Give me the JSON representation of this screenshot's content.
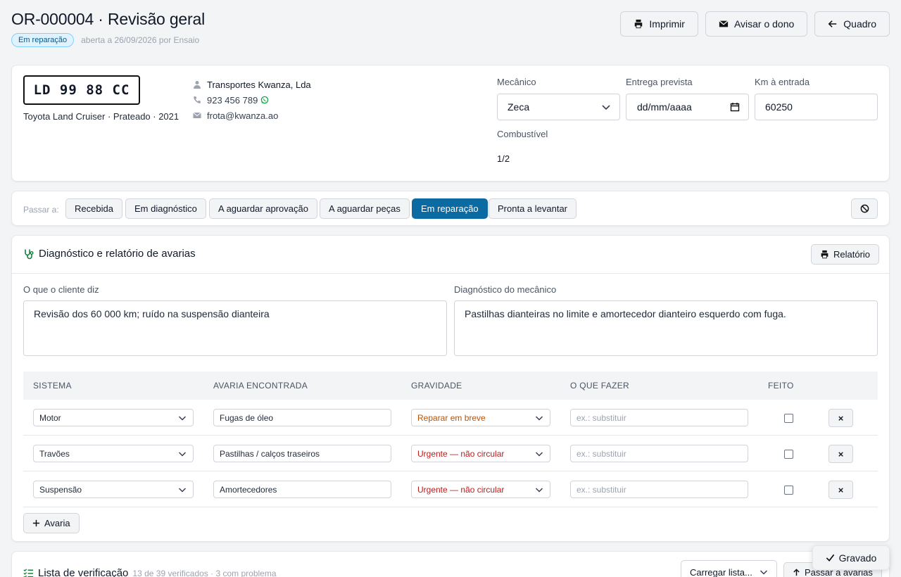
{
  "header": {
    "title": "OR-000004 · Revisão geral",
    "status_badge": "Em reparação",
    "meta": "aberta a 26/09/2026 por Ensaio",
    "buttons": {
      "print": "Imprimir",
      "notify": "Avisar o dono",
      "board": "Quadro"
    }
  },
  "vehicle": {
    "plate": "LD 99 88 CC",
    "description": "Toyota Land Cruiser · Prateado · 2021"
  },
  "customer": {
    "name": "Transportes Kwanza, Lda",
    "phone": "923 456 789",
    "email": "frota@kwanza.ao"
  },
  "fields": {
    "mechanic_label": "Mecânico",
    "mechanic_value": "Zeca",
    "delivery_label": "Entrega prevista",
    "delivery_value": "dd/mm/aaaa",
    "km_label": "Km à entrada",
    "km_value": "60250",
    "fuel_label": "Combustível",
    "fuel_value": "1/2"
  },
  "status_bar": {
    "label": "Passar a:",
    "options": [
      "Recebida",
      "Em diagnóstico",
      "A aguardar aprovação",
      "A aguardar peças",
      "Em reparação",
      "Pronta a levantar"
    ],
    "active": "Em reparação"
  },
  "diagnostic": {
    "title": "Diagnóstico e relatório de avarias",
    "report_button": "Relatório",
    "client_label": "O que o cliente diz",
    "client_text": "Revisão dos 60 000 km; ruído na suspensão dianteira",
    "mech_label": "Diagnóstico do mecânico",
    "mech_text": "Pastilhas dianteiras no limite e amortecedor dianteiro esquerdo com fuga.",
    "columns": [
      "SISTEMA",
      "AVARIA ENCONTRADA",
      "GRAVIDADE",
      "O QUE FAZER",
      "FEITO"
    ],
    "rows": [
      {
        "system": "Motor",
        "fault": "Fugas de óleo",
        "severity": "Reparar em breve",
        "todo_placeholder": "ex.: substituir",
        "done": false
      },
      {
        "system": "Travões",
        "fault": "Pastilhas / calços traseiros",
        "severity": "Urgente — não circular",
        "todo_placeholder": "ex.: substituir",
        "done": false
      },
      {
        "system": "Suspensão",
        "fault": "Amortecedores",
        "severity": "Urgente — não circular",
        "todo_placeholder": "ex.: substituir",
        "done": false
      }
    ],
    "add_button": "Avaria",
    "remove_label": "×"
  },
  "checklist": {
    "title": "Lista de verificação",
    "summary": "13 de 39 verificados · 3 com problema",
    "load_button": "Carregar lista...",
    "move_button": "Passar a avarias"
  },
  "toast": {
    "text": "Gravado"
  },
  "colors": {
    "accent": "#0b6aa2",
    "severity_soon": "#b45309",
    "severity_urgent": "#b91c1c",
    "badge_bg": "#e0f2fe",
    "whatsapp": "#16a34a"
  }
}
